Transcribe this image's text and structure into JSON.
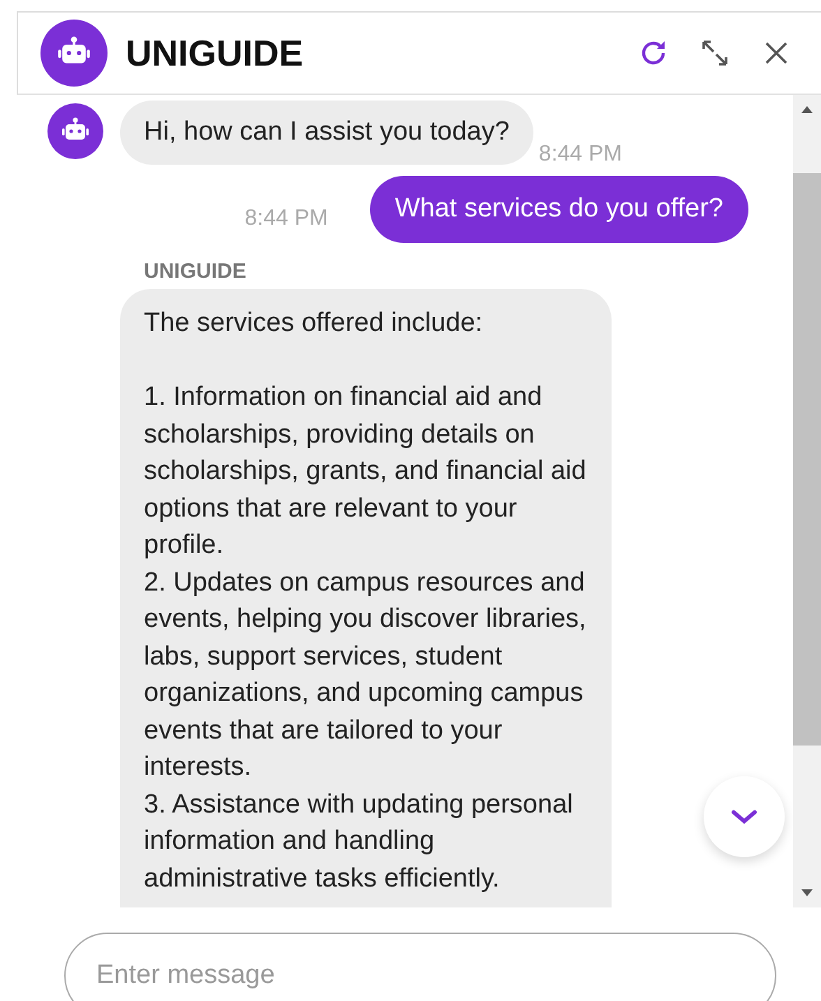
{
  "header": {
    "title": "UNIGUIDE"
  },
  "messages": [
    {
      "kind": "bot",
      "text": "Hi, how can I assist you today?",
      "time": "8:44 PM"
    },
    {
      "kind": "user",
      "text": "What services do you offer?",
      "time": "8:44 PM"
    },
    {
      "kind": "bot_named",
      "name": "UNIGUIDE",
      "paragraphs": [
        "The services offered include:",
        "1. Information on financial aid and scholarships, providing details on scholarships, grants, and financial aid options that are relevant to your profile.",
        "2. Updates on campus resources and events, helping you discover libraries, labs, support services, student organizations, and upcoming campus events that are tailored to your interests.",
        "3. Assistance with updating personal information and handling administrative tasks efficiently."
      ]
    }
  ],
  "input": {
    "placeholder": "Enter message"
  }
}
